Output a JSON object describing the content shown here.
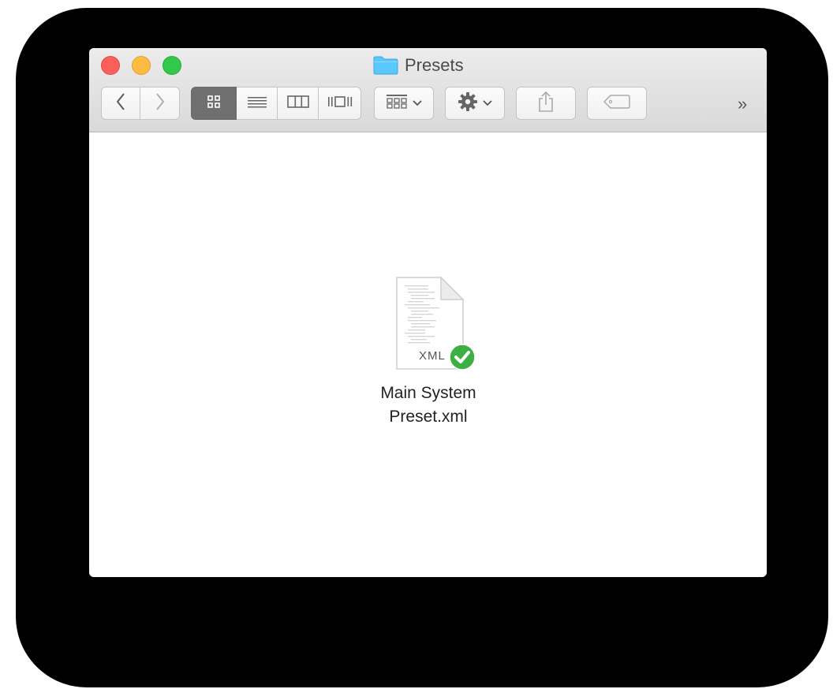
{
  "window": {
    "title": "Presets"
  },
  "toolbar": {
    "back_icon": "chevron-left-icon",
    "forward_icon": "chevron-right-icon",
    "view_modes": [
      "icon-view",
      "list-view",
      "column-view",
      "cover-flow-view"
    ],
    "active_view": "icon-view",
    "overflow_label": "»"
  },
  "content": {
    "files": [
      {
        "name": "Main System Preset.xml",
        "name_line1": "Main System",
        "name_line2": "Preset.xml",
        "type_label": "XML",
        "status_icon": "checkmark-badge-icon"
      }
    ]
  },
  "colors": {
    "close": "#fc605c",
    "minimize": "#fdbc40",
    "maximize": "#34c84a",
    "folder": "#5ac8fa",
    "badge": "#3cb043",
    "active_segment": "#6f6f6f"
  }
}
